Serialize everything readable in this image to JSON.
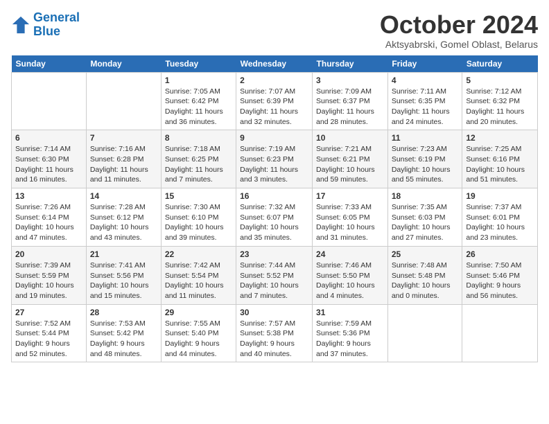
{
  "header": {
    "logo_line1": "General",
    "logo_line2": "Blue",
    "month": "October 2024",
    "location": "Aktsyabrski, Gomel Oblast, Belarus"
  },
  "weekdays": [
    "Sunday",
    "Monday",
    "Tuesday",
    "Wednesday",
    "Thursday",
    "Friday",
    "Saturday"
  ],
  "weeks": [
    [
      {
        "day": "",
        "sunrise": "",
        "sunset": "",
        "daylight": ""
      },
      {
        "day": "",
        "sunrise": "",
        "sunset": "",
        "daylight": ""
      },
      {
        "day": "1",
        "sunrise": "Sunrise: 7:05 AM",
        "sunset": "Sunset: 6:42 PM",
        "daylight": "Daylight: 11 hours and 36 minutes."
      },
      {
        "day": "2",
        "sunrise": "Sunrise: 7:07 AM",
        "sunset": "Sunset: 6:39 PM",
        "daylight": "Daylight: 11 hours and 32 minutes."
      },
      {
        "day": "3",
        "sunrise": "Sunrise: 7:09 AM",
        "sunset": "Sunset: 6:37 PM",
        "daylight": "Daylight: 11 hours and 28 minutes."
      },
      {
        "day": "4",
        "sunrise": "Sunrise: 7:11 AM",
        "sunset": "Sunset: 6:35 PM",
        "daylight": "Daylight: 11 hours and 24 minutes."
      },
      {
        "day": "5",
        "sunrise": "Sunrise: 7:12 AM",
        "sunset": "Sunset: 6:32 PM",
        "daylight": "Daylight: 11 hours and 20 minutes."
      }
    ],
    [
      {
        "day": "6",
        "sunrise": "Sunrise: 7:14 AM",
        "sunset": "Sunset: 6:30 PM",
        "daylight": "Daylight: 11 hours and 16 minutes."
      },
      {
        "day": "7",
        "sunrise": "Sunrise: 7:16 AM",
        "sunset": "Sunset: 6:28 PM",
        "daylight": "Daylight: 11 hours and 11 minutes."
      },
      {
        "day": "8",
        "sunrise": "Sunrise: 7:18 AM",
        "sunset": "Sunset: 6:25 PM",
        "daylight": "Daylight: 11 hours and 7 minutes."
      },
      {
        "day": "9",
        "sunrise": "Sunrise: 7:19 AM",
        "sunset": "Sunset: 6:23 PM",
        "daylight": "Daylight: 11 hours and 3 minutes."
      },
      {
        "day": "10",
        "sunrise": "Sunrise: 7:21 AM",
        "sunset": "Sunset: 6:21 PM",
        "daylight": "Daylight: 10 hours and 59 minutes."
      },
      {
        "day": "11",
        "sunrise": "Sunrise: 7:23 AM",
        "sunset": "Sunset: 6:19 PM",
        "daylight": "Daylight: 10 hours and 55 minutes."
      },
      {
        "day": "12",
        "sunrise": "Sunrise: 7:25 AM",
        "sunset": "Sunset: 6:16 PM",
        "daylight": "Daylight: 10 hours and 51 minutes."
      }
    ],
    [
      {
        "day": "13",
        "sunrise": "Sunrise: 7:26 AM",
        "sunset": "Sunset: 6:14 PM",
        "daylight": "Daylight: 10 hours and 47 minutes."
      },
      {
        "day": "14",
        "sunrise": "Sunrise: 7:28 AM",
        "sunset": "Sunset: 6:12 PM",
        "daylight": "Daylight: 10 hours and 43 minutes."
      },
      {
        "day": "15",
        "sunrise": "Sunrise: 7:30 AM",
        "sunset": "Sunset: 6:10 PM",
        "daylight": "Daylight: 10 hours and 39 minutes."
      },
      {
        "day": "16",
        "sunrise": "Sunrise: 7:32 AM",
        "sunset": "Sunset: 6:07 PM",
        "daylight": "Daylight: 10 hours and 35 minutes."
      },
      {
        "day": "17",
        "sunrise": "Sunrise: 7:33 AM",
        "sunset": "Sunset: 6:05 PM",
        "daylight": "Daylight: 10 hours and 31 minutes."
      },
      {
        "day": "18",
        "sunrise": "Sunrise: 7:35 AM",
        "sunset": "Sunset: 6:03 PM",
        "daylight": "Daylight: 10 hours and 27 minutes."
      },
      {
        "day": "19",
        "sunrise": "Sunrise: 7:37 AM",
        "sunset": "Sunset: 6:01 PM",
        "daylight": "Daylight: 10 hours and 23 minutes."
      }
    ],
    [
      {
        "day": "20",
        "sunrise": "Sunrise: 7:39 AM",
        "sunset": "Sunset: 5:59 PM",
        "daylight": "Daylight: 10 hours and 19 minutes."
      },
      {
        "day": "21",
        "sunrise": "Sunrise: 7:41 AM",
        "sunset": "Sunset: 5:56 PM",
        "daylight": "Daylight: 10 hours and 15 minutes."
      },
      {
        "day": "22",
        "sunrise": "Sunrise: 7:42 AM",
        "sunset": "Sunset: 5:54 PM",
        "daylight": "Daylight: 10 hours and 11 minutes."
      },
      {
        "day": "23",
        "sunrise": "Sunrise: 7:44 AM",
        "sunset": "Sunset: 5:52 PM",
        "daylight": "Daylight: 10 hours and 7 minutes."
      },
      {
        "day": "24",
        "sunrise": "Sunrise: 7:46 AM",
        "sunset": "Sunset: 5:50 PM",
        "daylight": "Daylight: 10 hours and 4 minutes."
      },
      {
        "day": "25",
        "sunrise": "Sunrise: 7:48 AM",
        "sunset": "Sunset: 5:48 PM",
        "daylight": "Daylight: 10 hours and 0 minutes."
      },
      {
        "day": "26",
        "sunrise": "Sunrise: 7:50 AM",
        "sunset": "Sunset: 5:46 PM",
        "daylight": "Daylight: 9 hours and 56 minutes."
      }
    ],
    [
      {
        "day": "27",
        "sunrise": "Sunrise: 7:52 AM",
        "sunset": "Sunset: 5:44 PM",
        "daylight": "Daylight: 9 hours and 52 minutes."
      },
      {
        "day": "28",
        "sunrise": "Sunrise: 7:53 AM",
        "sunset": "Sunset: 5:42 PM",
        "daylight": "Daylight: 9 hours and 48 minutes."
      },
      {
        "day": "29",
        "sunrise": "Sunrise: 7:55 AM",
        "sunset": "Sunset: 5:40 PM",
        "daylight": "Daylight: 9 hours and 44 minutes."
      },
      {
        "day": "30",
        "sunrise": "Sunrise: 7:57 AM",
        "sunset": "Sunset: 5:38 PM",
        "daylight": "Daylight: 9 hours and 40 minutes."
      },
      {
        "day": "31",
        "sunrise": "Sunrise: 7:59 AM",
        "sunset": "Sunset: 5:36 PM",
        "daylight": "Daylight: 9 hours and 37 minutes."
      },
      {
        "day": "",
        "sunrise": "",
        "sunset": "",
        "daylight": ""
      },
      {
        "day": "",
        "sunrise": "",
        "sunset": "",
        "daylight": ""
      }
    ]
  ]
}
